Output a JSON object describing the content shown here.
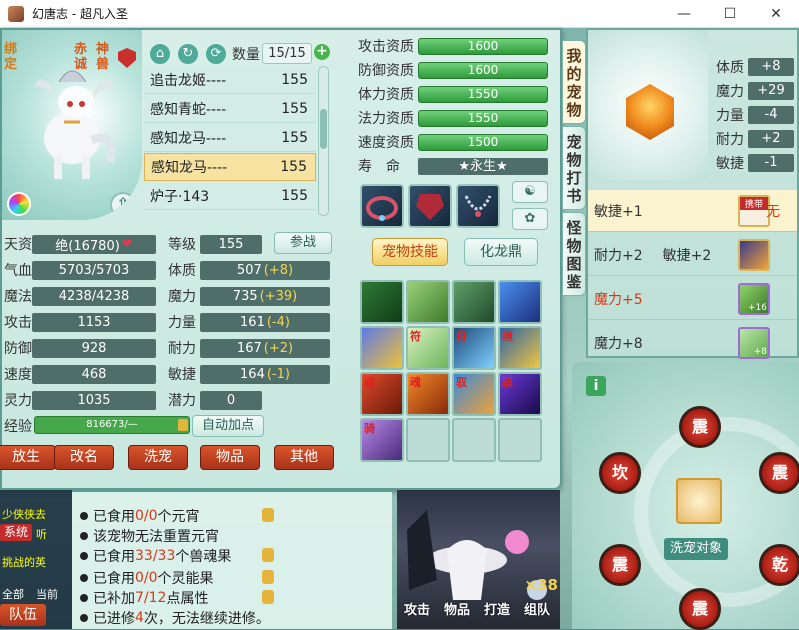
{
  "window": {
    "title": "幻唐志 - 超凡入圣",
    "min": "—",
    "max": "☐",
    "close": "✕"
  },
  "portrait": {
    "tag_bang": "绑定",
    "tag_chi": "赤诚",
    "tag_shen": "神兽"
  },
  "list_header": {
    "count_label": "数量",
    "count_value": "15/15",
    "plus": "+"
  },
  "pets": [
    {
      "name": "追击龙姬----",
      "level": "155"
    },
    {
      "name": "感知青蛇----",
      "level": "155"
    },
    {
      "name": "感知龙马----",
      "level": "155"
    },
    {
      "name": "感知龙马----",
      "level": "155"
    },
    {
      "name": "炉子·143",
      "level": "155"
    }
  ],
  "stats": {
    "tianzi_label": "天资",
    "tianzi_value": "绝(16780)",
    "heart": "❤",
    "dengji_label": "等级",
    "dengji_value": "155",
    "canzhan": "参战",
    "qixue_label": "气血",
    "qixue_value": "5703/5703",
    "tizhi_label": "体质",
    "tizhi_value": "507",
    "tizhi_bonus": "(+8)",
    "mofa_label": "魔法",
    "mofa_value": "4238/4238",
    "moli_label": "魔力",
    "moli_value": "735",
    "moli_bonus": "(+39)",
    "gongji_label": "攻击",
    "gongji_value": "1153",
    "liliang_label": "力量",
    "liliang_value": "161",
    "liliang_bonus": "(-4)",
    "fangyu_label": "防御",
    "fangyu_value": "928",
    "naili_label": "耐力",
    "naili_value": "167",
    "naili_bonus": "(+2)",
    "sudu_label": "速度",
    "sudu_value": "468",
    "minjie_label": "敏捷",
    "minjie_value": "164",
    "minjie_bonus": "(-1)",
    "lingli_label": "灵力",
    "lingli_value": "1035",
    "qianli_label": "潜力",
    "qianli_value": "0",
    "jingyan_label": "经验",
    "jingyan_value": "816673/—",
    "auto_points": "自动加点"
  },
  "bottom_buttons": [
    "放生",
    "改名",
    "洗宠",
    "物品",
    "其他"
  ],
  "aptitudes": [
    {
      "label": "攻击资质",
      "value": "1600"
    },
    {
      "label": "防御资质",
      "value": "1600"
    },
    {
      "label": "体力资质",
      "value": "1550"
    },
    {
      "label": "法力资质",
      "value": "1550"
    },
    {
      "label": "速度资质",
      "value": "1500"
    }
  ],
  "life": {
    "label": "寿　命",
    "value": "★永生★"
  },
  "skill_tabs": {
    "pet_skill": "宠物技能",
    "hualong": "化龙鼎"
  },
  "skill_marks": [
    "",
    "",
    "",
    "",
    "",
    "符",
    "符",
    "境",
    "魂",
    "魂",
    "驭",
    "驭",
    "骑",
    "",
    "",
    ""
  ],
  "side_tabs": [
    "我的宠物",
    "宠物打书",
    "怪物图鉴"
  ],
  "right_attrs": [
    {
      "label": "体质",
      "value": "+8"
    },
    {
      "label": "魔力",
      "value": "+29"
    },
    {
      "label": "力量",
      "value": "-4"
    },
    {
      "label": "耐力",
      "value": "+2"
    },
    {
      "label": "敏捷",
      "value": "-1"
    }
  ],
  "bonus_rows": [
    {
      "text": "敏捷+1",
      "extra": "",
      "tag": "携带",
      "right": "无"
    },
    {
      "text": "耐力+2",
      "extra": "敏捷+2",
      "tag": "",
      "right": ""
    },
    {
      "text": "魔力+5",
      "extra": "",
      "tag": "",
      "right": ""
    },
    {
      "text": "魔力+8",
      "extra": "",
      "tag": "",
      "right": ""
    }
  ],
  "bonus_badges": {
    "row3": "+16",
    "row4": "+8"
  },
  "info_lines": [
    {
      "pre": "已食用",
      "num": "0/0",
      "post": "个元宵"
    },
    {
      "pre": "该宠物无法重置元宵",
      "num": "",
      "post": ""
    },
    {
      "pre": "已食用",
      "num": "33/33",
      "post": "个兽魂果"
    },
    {
      "pre": "已食用",
      "num": "0/0",
      "post": "个灵能果"
    },
    {
      "pre": "已补加",
      "num": "7/12",
      "post": "点属性"
    },
    {
      "pre": "已进修",
      "num": "4",
      "post": "次，无法继续进修。"
    }
  ],
  "chat": {
    "line1": "少侠侠去",
    "line2": "听",
    "system": "系统",
    "line3": "挑战的英",
    "all": "全部",
    "current": "当前",
    "team": "队伍"
  },
  "scene_buttons": [
    "攻击",
    "物品",
    "打造",
    "组队"
  ],
  "scene_number": "×38",
  "wheel": {
    "info": "i",
    "seals": [
      "震",
      "坎",
      "震",
      "震",
      "乾",
      "震"
    ],
    "wash_target": "洗宠对象"
  }
}
